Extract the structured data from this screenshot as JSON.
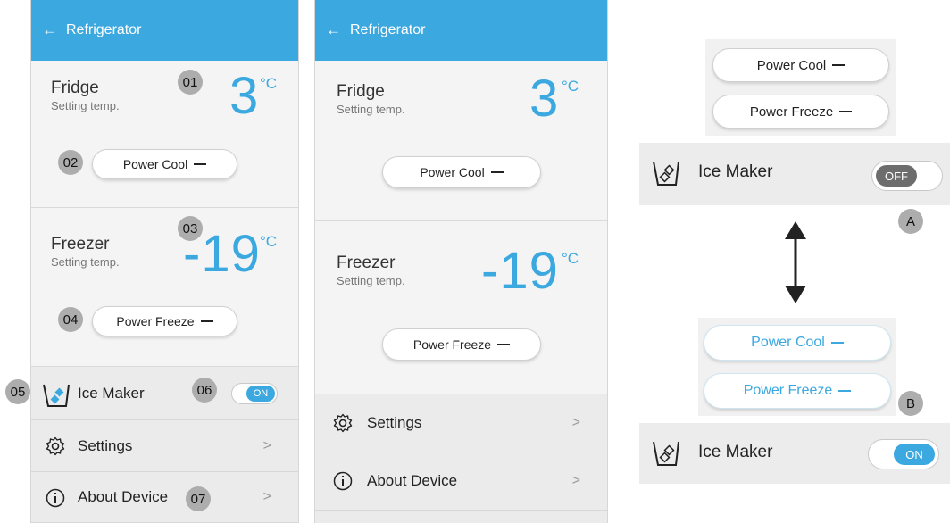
{
  "phone_a": {
    "appbar": {
      "back_arrow": "←",
      "title": "Refrigerator"
    },
    "fridge": {
      "name": "Fridge",
      "subtitle": "Setting temp.",
      "temp": "3",
      "unit": "°C"
    },
    "power_cool": {
      "label": "Power Cool"
    },
    "freezer": {
      "name": "Freezer",
      "subtitle": "Setting temp.",
      "temp": "-19",
      "unit": "°C"
    },
    "power_freeze": {
      "label": "Power Freeze"
    },
    "ice_maker": {
      "label": "Ice Maker",
      "toggle": "ON"
    },
    "settings": {
      "label": "Settings",
      "chevron": ">"
    },
    "about": {
      "label": "About Device",
      "chevron": ">"
    },
    "badges": [
      "01",
      "02",
      "03",
      "04",
      "05",
      "06",
      "07"
    ]
  },
  "phone_b": {
    "appbar": {
      "back_arrow": "←",
      "title": "Refrigerator"
    },
    "fridge": {
      "name": "Fridge",
      "subtitle": "Setting temp.",
      "temp": "3",
      "unit": "°C"
    },
    "power_cool": {
      "label": "Power Cool"
    },
    "freezer": {
      "name": "Freezer",
      "subtitle": "Setting temp.",
      "temp": "-19",
      "unit": "°C"
    },
    "power_freeze": {
      "label": "Power Freeze"
    },
    "settings": {
      "label": "Settings",
      "chevron": ">"
    },
    "about": {
      "label": "About Device",
      "chevron": ">"
    }
  },
  "callouts": {
    "top": {
      "power_cool": "Power Cool",
      "power_freeze": "Power Freeze",
      "ice_maker": "Ice Maker",
      "toggle": "OFF",
      "marker": "A"
    },
    "bottom": {
      "power_cool": "Power Cool",
      "power_freeze": "Power Freeze",
      "ice_maker": "Ice Maker",
      "toggle": "ON",
      "marker": "B"
    }
  },
  "colors": {
    "accent": "#3ba8e0",
    "badge": "#adadad",
    "toggle_off": "#6d6d6d"
  },
  "icons": [
    "back-arrow-icon",
    "ice-maker-icon",
    "gear-icon",
    "info-icon",
    "chevron-right-icon",
    "double-arrow-icon"
  ]
}
